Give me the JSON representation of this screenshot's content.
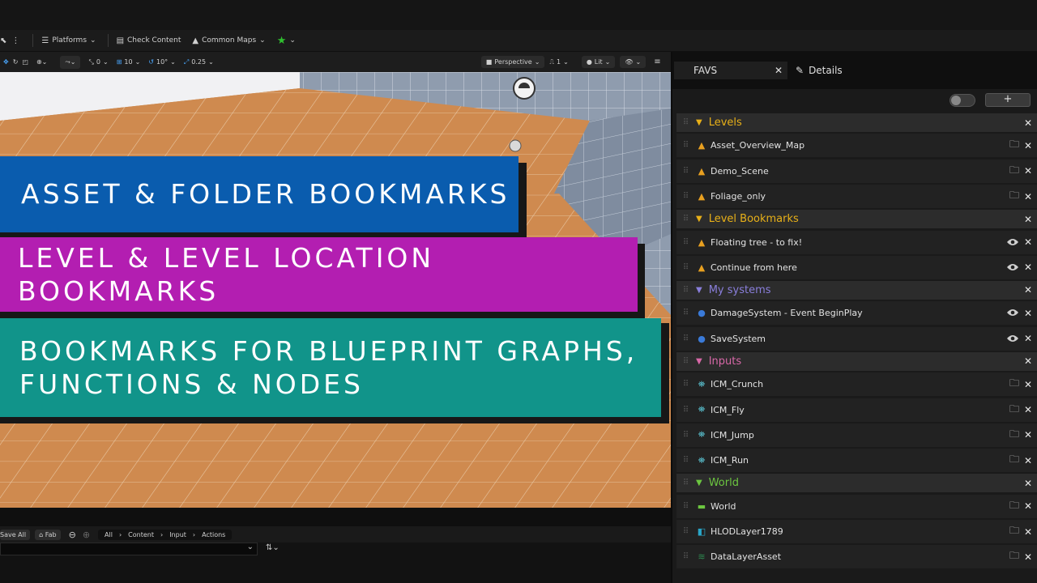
{
  "toolbar": {
    "platforms": "Platforms",
    "check_content": "Check Content",
    "common_maps": "Common Maps"
  },
  "viewport": {
    "snap_rotate": "0",
    "grid_size": "10",
    "rotation_snap": "10°",
    "scale_snap": "0.25",
    "view_mode": "Perspective",
    "camera_speed": "1",
    "lit": "Lit"
  },
  "banners": [
    {
      "line1": "Asset & Folder Bookmarks",
      "line2": ""
    },
    {
      "line1": "Level & Level Location Bookmarks",
      "line2": ""
    },
    {
      "line1": "Bookmarks for Blueprint Graphs,",
      "line2": "Functions & Nodes"
    }
  ],
  "bottom": {
    "save_all": "Save All",
    "fab": "Fab",
    "breadcrumb": [
      "All",
      "Content",
      "Input",
      "Actions"
    ]
  },
  "panel": {
    "tab_favs": "FAVS",
    "tab_details": "Details",
    "add_label": "+",
    "groups": [
      {
        "title": "Levels",
        "color": "#e8b018",
        "items": [
          {
            "label": "Asset_Overview_Map",
            "icon": "level-icon",
            "action": "browse"
          },
          {
            "label": "Demo_Scene",
            "icon": "level-icon",
            "action": "browse"
          },
          {
            "label": "Foliage_only",
            "icon": "level-icon",
            "action": "browse"
          }
        ]
      },
      {
        "title": "Level Bookmarks",
        "color": "#e8b018",
        "items": [
          {
            "label": "Floating tree - to fix!",
            "icon": "level-icon",
            "action": "view"
          },
          {
            "label": "Continue from here",
            "icon": "level-icon",
            "action": "view"
          }
        ]
      },
      {
        "title": "My systems",
        "color": "#8a7fdc",
        "items": [
          {
            "label": "DamageSystem - Event BeginPlay",
            "icon": "blueprint-icon",
            "action": "view"
          },
          {
            "label": "SaveSystem",
            "icon": "blueprint-icon",
            "action": "view"
          }
        ]
      },
      {
        "title": "Inputs",
        "color": "#d868a8",
        "items": [
          {
            "label": "ICM_Crunch",
            "icon": "input-icon",
            "action": "browse"
          },
          {
            "label": "ICM_Fly",
            "icon": "input-icon",
            "action": "browse"
          },
          {
            "label": "ICM_Jump",
            "icon": "input-icon",
            "action": "browse"
          },
          {
            "label": "ICM_Run",
            "icon": "input-icon",
            "action": "browse"
          }
        ]
      },
      {
        "title": "World",
        "color": "#6cc640",
        "items": [
          {
            "label": "World",
            "icon": "folder-icon",
            "action": "browse"
          },
          {
            "label": "HLODLayer1789",
            "icon": "hlod-icon",
            "action": "browse"
          },
          {
            "label": "DataLayerAsset",
            "icon": "datalayer-icon",
            "action": "browse"
          }
        ]
      }
    ]
  }
}
